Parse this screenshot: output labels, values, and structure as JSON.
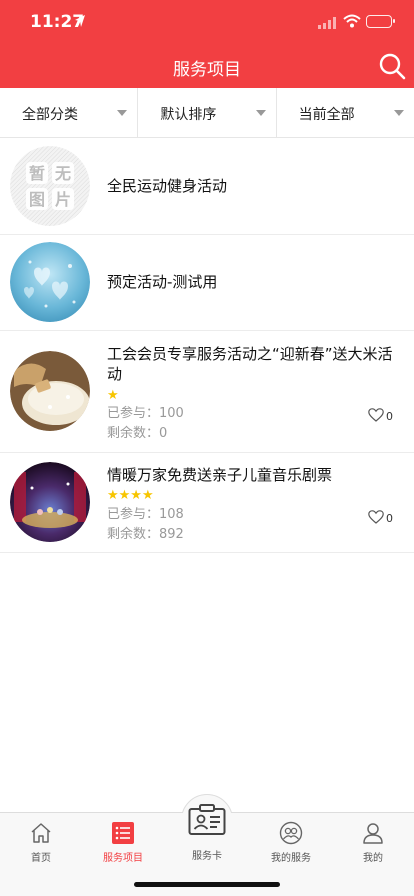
{
  "status_bar": {
    "time": "11:27"
  },
  "nav": {
    "title": "服务项目"
  },
  "filters": [
    {
      "label": "全部分类"
    },
    {
      "label": "默认排序"
    },
    {
      "label": "当前全部"
    }
  ],
  "items": [
    {
      "title": "全民运动健身活动",
      "thumb_text": "暂无图片"
    },
    {
      "title": "预定活动-测试用"
    },
    {
      "title": "工会会员专享服务活动之“迎新春”送大米活动",
      "stars": "★",
      "rating": 1,
      "joined_label": "已参与：100",
      "remaining_label": "剩余数：0",
      "likes": "0"
    },
    {
      "title": "情暖万家免费送亲子儿童音乐剧票",
      "stars": "★★★★",
      "rating": 4,
      "joined_label": "已参与：108",
      "remaining_label": "剩余数：892",
      "likes": "0"
    }
  ],
  "tabbar": {
    "home": "首页",
    "services": "服务项目",
    "card": "服务卡",
    "my_services": "我的服务",
    "mine": "我的"
  },
  "colors": {
    "brand": "#f23f42",
    "star": "#f7c500"
  }
}
